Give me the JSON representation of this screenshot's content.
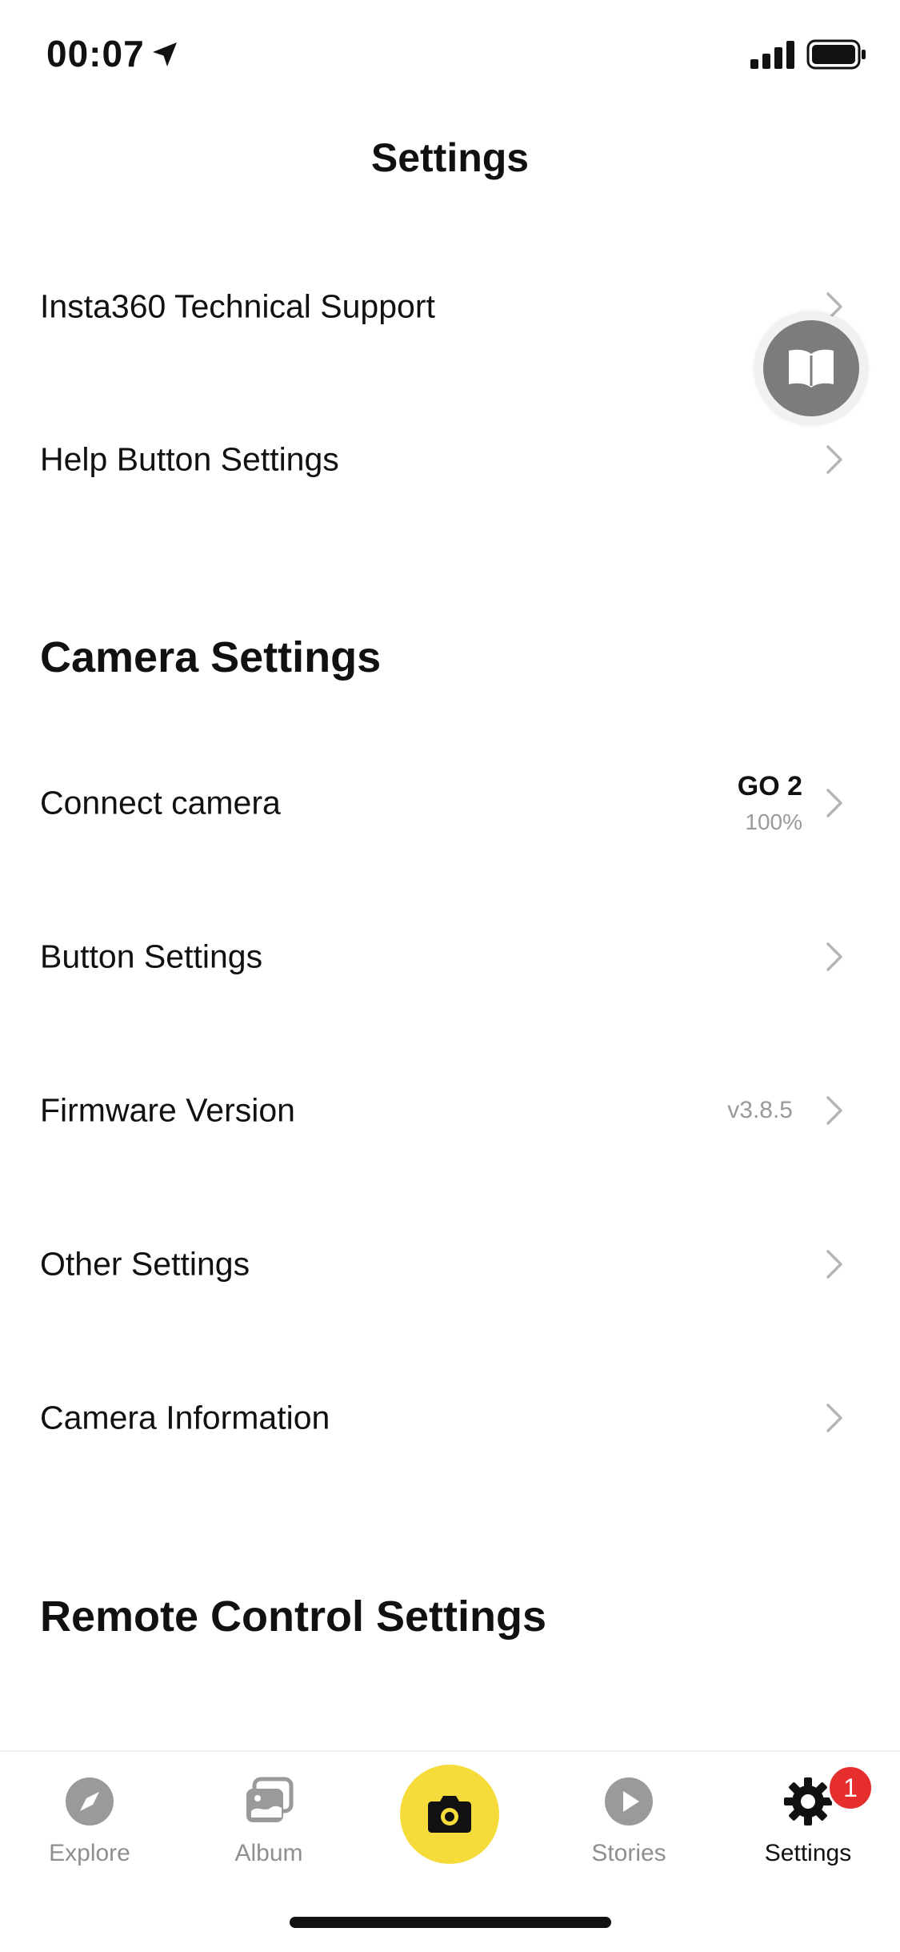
{
  "status_bar": {
    "time": "00:07"
  },
  "nav": {
    "title": "Settings"
  },
  "rows_top": [
    {
      "label": "Insta360 Technical Support"
    },
    {
      "label": "Help Button Settings"
    }
  ],
  "camera_section": {
    "title": "Camera Settings",
    "rows": [
      {
        "label": "Connect camera",
        "value": "GO 2",
        "sub_value": "100%"
      },
      {
        "label": "Button Settings"
      },
      {
        "label": "Firmware Version",
        "value": "v3.8.5"
      },
      {
        "label": "Other Settings"
      },
      {
        "label": "Camera Information"
      }
    ]
  },
  "remote_section": {
    "title": "Remote Control Settings"
  },
  "tab_bar": {
    "tabs": [
      {
        "label": "Explore",
        "icon": "compass-icon"
      },
      {
        "label": "Album",
        "icon": "album-icon"
      },
      {
        "label": "",
        "icon": "camera-icon"
      },
      {
        "label": "Stories",
        "icon": "play-icon"
      },
      {
        "label": "Settings",
        "icon": "gear-icon"
      }
    ],
    "active": "Settings",
    "badge": "1"
  },
  "colors": {
    "accent_yellow": "#f5dc3b",
    "badge_red": "#e62e2e",
    "muted_gray": "#9a9a9a",
    "inactive_tab": "#8f8f8f"
  }
}
